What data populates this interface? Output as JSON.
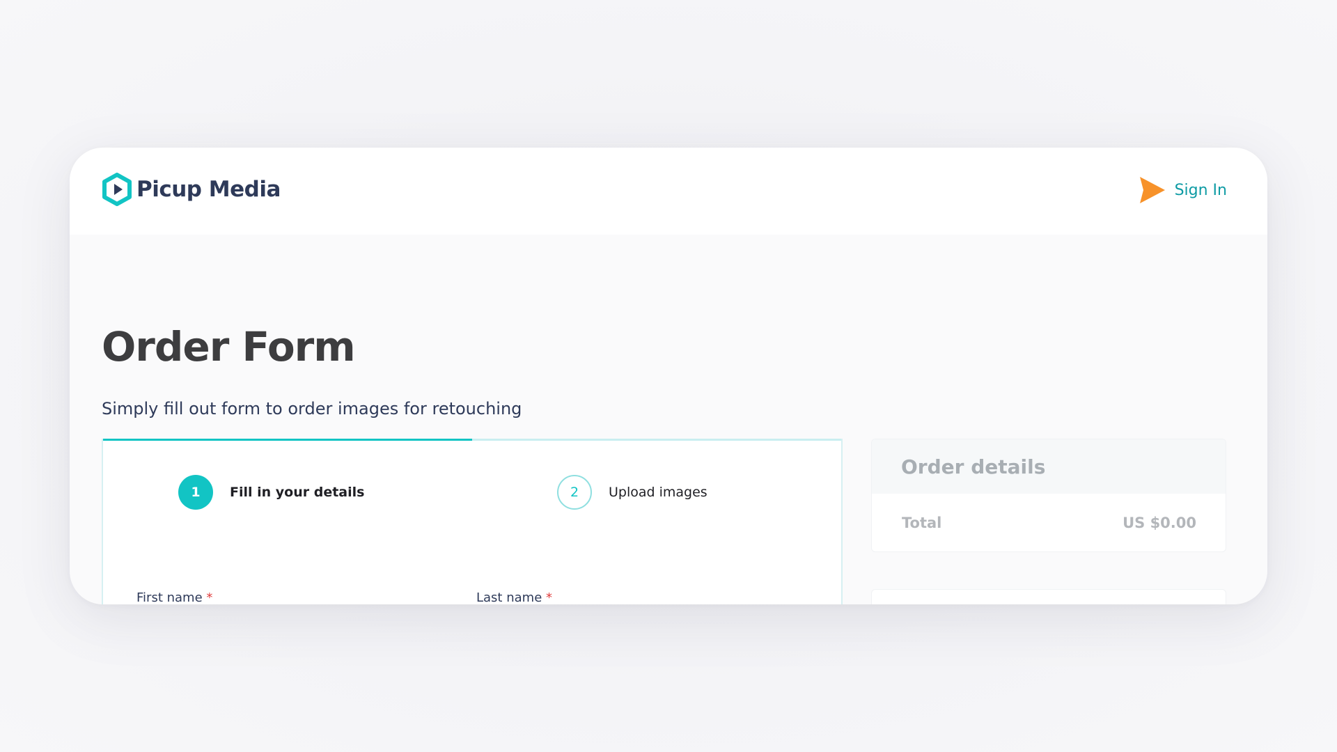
{
  "header": {
    "brand": "Picup Media",
    "sign_in_label": "Sign In"
  },
  "page": {
    "title": "Order Form",
    "subtitle": "Simply fill out form to order images for retouching"
  },
  "stepper": {
    "progress_fraction": 0.5,
    "steps": [
      {
        "number": "1",
        "label": "Fill in your details",
        "state": "active"
      },
      {
        "number": "2",
        "label": "Upload images",
        "state": "inactive"
      }
    ]
  },
  "form": {
    "first_name_label": "First name",
    "last_name_label": "Last name",
    "required_marker": "*"
  },
  "order": {
    "heading": "Order details",
    "total_label": "Total",
    "total_value": "US $0.00"
  },
  "colors": {
    "accent": "#12c4c4",
    "link": "#0e9ba4",
    "pointer": "#f7922a",
    "brand_text": "#2e3a59"
  }
}
